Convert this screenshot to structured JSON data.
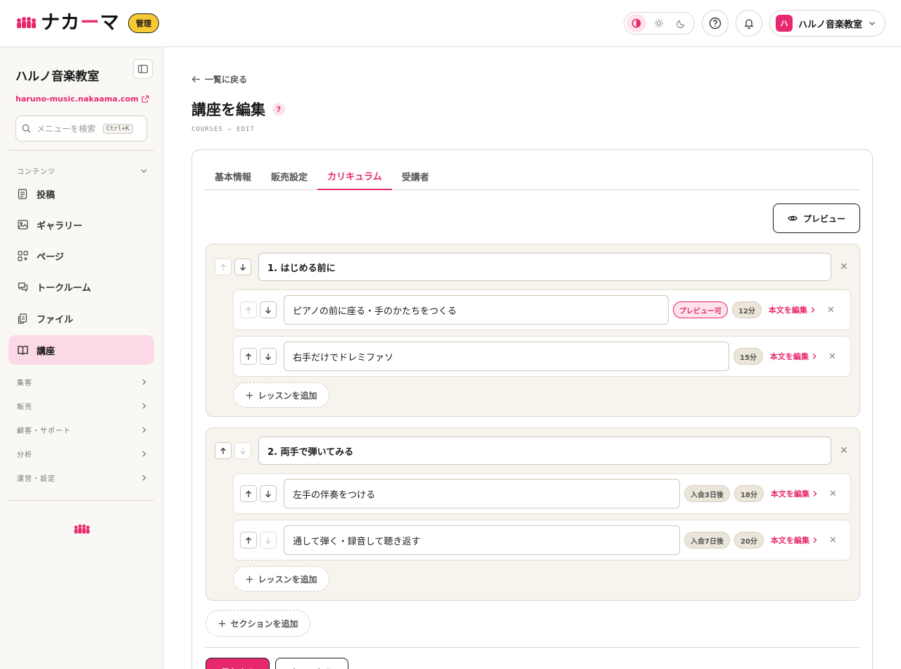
{
  "header": {
    "brand_name_prefix": "ナカ",
    "brand_name_accent": "ー",
    "brand_name_suffix": "マ",
    "admin_badge": "管理",
    "account_avatar": "ハ",
    "account_name": "ハルノ音楽教室"
  },
  "sidebar": {
    "site_title": "ハルノ音楽教室",
    "site_url": "haruno-music.nakaama.com",
    "search_placeholder": "メニューを検索",
    "search_shortcut": "Ctrl+K",
    "content_group": "コンテンツ",
    "items": [
      {
        "label": "投稿",
        "icon": "document-icon"
      },
      {
        "label": "ギャラリー",
        "icon": "image-icon"
      },
      {
        "label": "ページ",
        "icon": "pages-icon"
      },
      {
        "label": "トークルーム",
        "icon": "chat-icon"
      },
      {
        "label": "ファイル",
        "icon": "file-icon"
      },
      {
        "label": "講座",
        "icon": "book-icon",
        "active": true
      }
    ],
    "groups": [
      "集客",
      "販売",
      "顧客・サポート",
      "分析",
      "運営・設定"
    ]
  },
  "main": {
    "back_link": "一覧に戻る",
    "title": "講座を編集",
    "help": "?",
    "subtitle": "COURSES — EDIT",
    "tabs": [
      "基本情報",
      "販売設定",
      "カリキュラム",
      "受講者"
    ],
    "active_tab": "カリキュラム",
    "preview_button": "プレビュー",
    "sections": [
      {
        "title": "1. はじめる前に",
        "lessons": [
          {
            "title": "ピアノの前に座る・手のかたちをつくる",
            "preview": "プレビュー可",
            "duration": "12分",
            "edit": "本文を編集"
          },
          {
            "title": "右手だけでドレミファソ",
            "duration": "15分",
            "edit": "本文を編集"
          }
        ],
        "add_lesson": "レッスンを追加"
      },
      {
        "title": "2. 両手で弾いてみる",
        "lessons": [
          {
            "title": "左手の伴奏をつける",
            "drip": "入会3日後",
            "duration": "18分",
            "edit": "本文を編集"
          },
          {
            "title": "通して弾く・録音して聴き返す",
            "drip": "入会7日後",
            "duration": "20分",
            "edit": "本文を編集"
          }
        ],
        "add_lesson": "レッスンを追加"
      }
    ],
    "add_section": "セクションを追加",
    "save_button": "保存する",
    "cancel_button": "キャンセル"
  },
  "colors": {
    "accent": "#e8286e",
    "badge": "#f7c933",
    "section_bg": "#f7f4ee"
  }
}
